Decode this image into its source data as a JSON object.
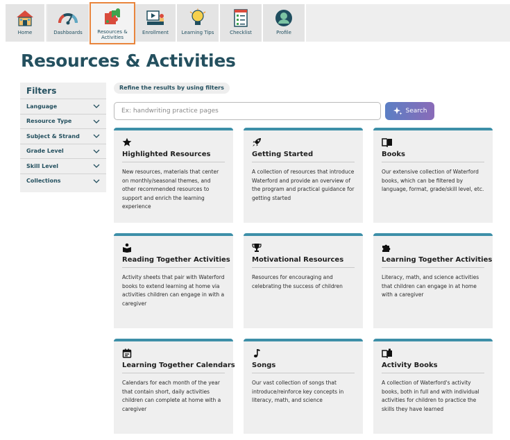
{
  "nav": {
    "items": [
      {
        "label": "Home",
        "icon": "house-icon"
      },
      {
        "label": "Dashboards",
        "icon": "gauge-icon"
      },
      {
        "label": "Resources & Activities",
        "icon": "puzzle-icon"
      },
      {
        "label": "Enrollment",
        "icon": "enrollment-icon"
      },
      {
        "label": "Learning Tips",
        "icon": "lightbulb-icon"
      },
      {
        "label": "Checklist",
        "icon": "checklist-icon"
      },
      {
        "label": "Profile",
        "icon": "profile-icon"
      }
    ],
    "active_color": "#e9853c"
  },
  "page": {
    "title": "Resources & Activities"
  },
  "filters": {
    "title": "Filters",
    "items": [
      "Language",
      "Resource Type",
      "Subject & Strand",
      "Grade Level",
      "Skill Level",
      "Collections"
    ]
  },
  "refine_label": "Refine the results by using filters",
  "search": {
    "placeholder": "Ex: handwriting practice pages",
    "button_label": "Search"
  },
  "cards": [
    {
      "icon": "star-icon",
      "title": "Highlighted Resources",
      "desc": "New resources, materials that center on monthly/seasonal themes, and other recommended resources to support and enrich the learning experience"
    },
    {
      "icon": "rocket-icon",
      "title": "Getting Started",
      "desc": "A collection of resources that introduce Waterford and provide an overview of the program and practical guidance for getting started"
    },
    {
      "icon": "book-icon",
      "title": "Books",
      "desc": "Our extensive collection of Waterford books, which can be filtered by language, format, grade/skill level, etc."
    },
    {
      "icon": "reading-icon",
      "title": "Reading Together Activities",
      "desc": "Activity sheets that pair with Waterford books to extend learning at home via activities children can engage in with a caregiver"
    },
    {
      "icon": "trophy-icon",
      "title": "Motivational Resources",
      "desc": "Resources for encouraging and celebrating the success of children"
    },
    {
      "icon": "puzzle-piece-icon",
      "title": "Learning Together Activities",
      "desc": "Literacy, math, and science activities that children can engage in at home with a caregiver"
    },
    {
      "icon": "calendar-icon",
      "title": "Learning Together Calendars",
      "desc": "Calendars for each month of the year that contain short, daily activities children can complete at home with a caregiver"
    },
    {
      "icon": "music-note-icon",
      "title": "Songs",
      "desc": "Our vast collection of songs that introduce/reinforce key concepts in literacy, math, and science"
    },
    {
      "icon": "activity-book-icon",
      "title": "Activity Books",
      "desc": "A collection of Waterford's activity books, both in full and with individual activities for children to practice the skills they have learned"
    }
  ],
  "colors": {
    "accent_teal": "#3d8fa8",
    "title_teal": "#24505f",
    "card_bg": "#efefef"
  }
}
